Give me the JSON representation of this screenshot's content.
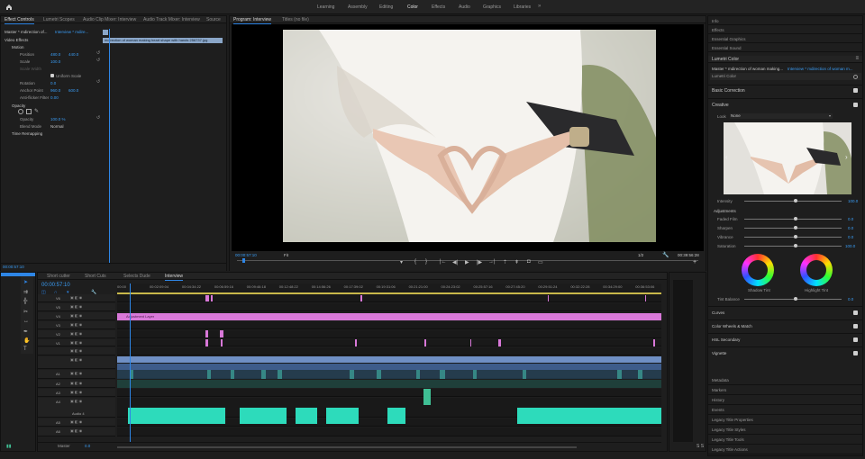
{
  "workspaces": [
    "Learning",
    "Assembly",
    "Editing",
    "Color",
    "Effects",
    "Audio",
    "Graphics",
    "Libraries"
  ],
  "active_workspace": "Color",
  "source_tabs": [
    "Effect Controls",
    "Lumetri Scopes",
    "Audio Clip Mixer: Interview",
    "Audio Track Mixer: Interview",
    "Source"
  ],
  "effect_controls": {
    "master": "Master * mdirection of...",
    "sequence": "Interview * mdire...",
    "clip_name": "mdirection of woman making heart shape with hands 256737.jpg",
    "video_effects": "Video Effects",
    "motion": "Motion",
    "position_label": "Position",
    "position_x": "480.0",
    "position_y": "440.0",
    "scale_label": "Scale",
    "scale_value": "100.0",
    "scale_width_label": "Scale Width",
    "uniform_scale": "Uniform Scale",
    "rotation_label": "Rotation",
    "rotation_value": "0.0",
    "anchor_label": "Anchor Point",
    "anchor_x": "960.0",
    "anchor_y": "600.0",
    "antiflicker_label": "Anti-flicker Filter",
    "antiflicker_value": "0.00",
    "opacity": "Opacity",
    "opacity_label": "Opacity",
    "opacity_value": "100.0 %",
    "blend_label": "Blend Mode",
    "blend_value": "Normal",
    "time_remap": "Time Remapping",
    "timecode": "00:00:57:10"
  },
  "program": {
    "tabs": [
      "Program: Interview",
      "Titles (no file)"
    ],
    "timecode": "00:00:57:10",
    "fit": "Fit",
    "quality": "1/2",
    "duration": "00:39:56:28"
  },
  "timeline": {
    "tabs": [
      "Short cutter",
      "Short Cuts",
      "Selects Dude",
      "Interview"
    ],
    "timecode": "00:00:57:10",
    "ruler": [
      "00:00",
      "00:02:09:04",
      "00:04:34:22",
      "00:06:59:16",
      "00:09:46:18",
      "00:12:48:22",
      "00:14:56:26",
      "00:17:39:02",
      "00:19:31:06",
      "00:21:21:00",
      "00:24:23:02",
      "00:25:57:16",
      "00:27:45:20",
      "00:29:51:24",
      "00:32:22:28",
      "00:34:29:00",
      "00:36:53:06"
    ],
    "video_tracks": [
      "V6",
      "V5",
      "V4",
      "V3",
      "V2",
      "V1"
    ],
    "audio_tracks": [
      "A1",
      "A2",
      "A3",
      "A4",
      "A5",
      "A6"
    ],
    "adjustment_layer": "Adjustment Layer",
    "audio_label": "Audio 4",
    "master": "Master",
    "master_value": "0.0"
  },
  "right_panels": {
    "top": [
      "Info",
      "Effects",
      "Essential Graphics",
      "Essential Sound"
    ],
    "lumetri_title": "Lumetri Color",
    "master": "Master * mdirection of woman making...",
    "seq": "Interview * mdirection of woman m...",
    "effect": "Lumetri Color",
    "basic_correction": "Basic Correction",
    "creative": "Creative",
    "look_label": "Look",
    "look_value": "None",
    "intensity_label": "Intensity",
    "intensity_value": "100.0",
    "adjustments": "Adjustments",
    "faded_label": "Faded Film",
    "faded_value": "0.0",
    "sharpen_label": "Sharpen",
    "sharpen_value": "0.0",
    "vibrance_label": "Vibrance",
    "vibrance_value": "0.0",
    "saturation_label": "Saturation",
    "saturation_value": "100.0",
    "shadow_tint": "Shadow Tint",
    "highlight_tint": "Highlight Tint",
    "tint_balance_label": "Tint Balance",
    "tint_balance_value": "0.0",
    "sections": [
      "Curves",
      "Color Wheels & Match",
      "HSL Secondary",
      "Vignette"
    ],
    "bottom": [
      "Metadata",
      "Markers",
      "History",
      "Events",
      "Legacy Title Properties",
      "Legacy Title Styles",
      "Legacy Title Tools",
      "Legacy Title Actions"
    ]
  },
  "colors": {
    "accent": "#2e86e6",
    "pink": "#d878d8",
    "blue_clip": "#6f8fc4",
    "teal": "#2ddbbb",
    "green": "#3fbf94"
  }
}
